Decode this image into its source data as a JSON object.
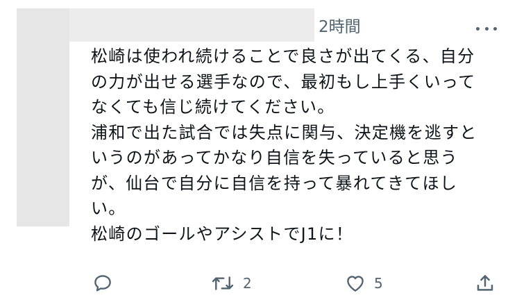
{
  "tweet": {
    "timestamp": "2時間",
    "lines": [
      "松崎は使われ続けることで良さが出てくる、自分",
      "の力が出せる選手なので、最初もし上手くいって",
      "なくても信じ続けてください。",
      "浦和で出た試合では失点に関与、決定機を逃すと",
      "いうのがあってかなり自信を失っていると思う",
      "が、仙台で自分に自信を持って暴れてきてほし",
      "い。",
      "松崎のゴールやアシストでJ1に！"
    ]
  },
  "actions": {
    "reply_icon": "reply-bubble-icon",
    "retweet_icon": "retweet-arrows-icon",
    "retweet_count": "2",
    "like_icon": "heart-icon",
    "like_count": "5",
    "share_icon": "share-upload-icon"
  },
  "colors": {
    "text": "#0f1419",
    "secondary": "#536471",
    "redaction": "#e6e6e6"
  }
}
